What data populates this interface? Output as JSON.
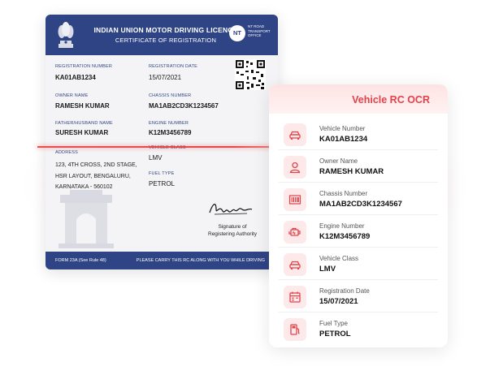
{
  "card": {
    "title": "INDIAN UNION MOTOR DRIVING LICENCE",
    "subtitle": "CERTIFICATE OF REGISTRATION",
    "nt_badge": "NT",
    "nt_text": "NT ROAD TRANSPORT OFFICE",
    "fields": {
      "registration_number": {
        "label": "REGISTRATION NUMBER",
        "value": "KA01AB1234"
      },
      "registration_date": {
        "label": "REGISTRATION DATE",
        "value": "15/07/2021"
      },
      "owner_name": {
        "label": "OWNER NAME",
        "value": "RAMESH KUMAR"
      },
      "chassis_number": {
        "label": "CHASSIS NUMBER",
        "value": "MA1AB2CD3K1234567"
      },
      "father_name": {
        "label": "FATHER/HUSBAND NAME",
        "value": "SURESH KUMAR"
      },
      "engine_number": {
        "label": "ENGINE NUMBER",
        "value": "K12M3456789"
      },
      "address": {
        "label": "ADDRESS",
        "lines": [
          "123, 4TH CROSS, 2ND STAGE,",
          "HSR LAYOUT, BENGALURU,",
          "KARNATAKA - 560102"
        ]
      },
      "vehicle_class": {
        "label": "VEHICLE CLASS",
        "value": "LMV"
      },
      "fuel_type": {
        "label": "FUEL TYPE",
        "value": "PETROL"
      }
    },
    "signature_text": [
      "Signature of",
      "Registering Authority"
    ],
    "footer_left": "FORM 23A (See Rule 48)",
    "footer_right": "PLEASE CARRY THIS RC ALONG WITH YOU WHILE DRIVING"
  },
  "panel": {
    "title": "Vehicle RC OCR",
    "accent": "#e2434b",
    "rows": [
      {
        "icon": "car-icon",
        "label": "Vehicle Number",
        "value": "KA01AB1234"
      },
      {
        "icon": "user-icon",
        "label": "Owner Name",
        "value": "RAMESH KUMAR"
      },
      {
        "icon": "barcode-icon",
        "label": "Chassis Number",
        "value": "MA1AB2CD3K1234567"
      },
      {
        "icon": "engine-icon",
        "label": "Engine Number",
        "value": "K12M3456789"
      },
      {
        "icon": "car-icon",
        "label": "Vehicle Class",
        "value": "LMV"
      },
      {
        "icon": "calendar-icon",
        "label": "Registration Date",
        "value": "15/07/2021"
      },
      {
        "icon": "fuel-pump-icon",
        "label": "Fuel Type",
        "value": "PETROL"
      }
    ]
  }
}
